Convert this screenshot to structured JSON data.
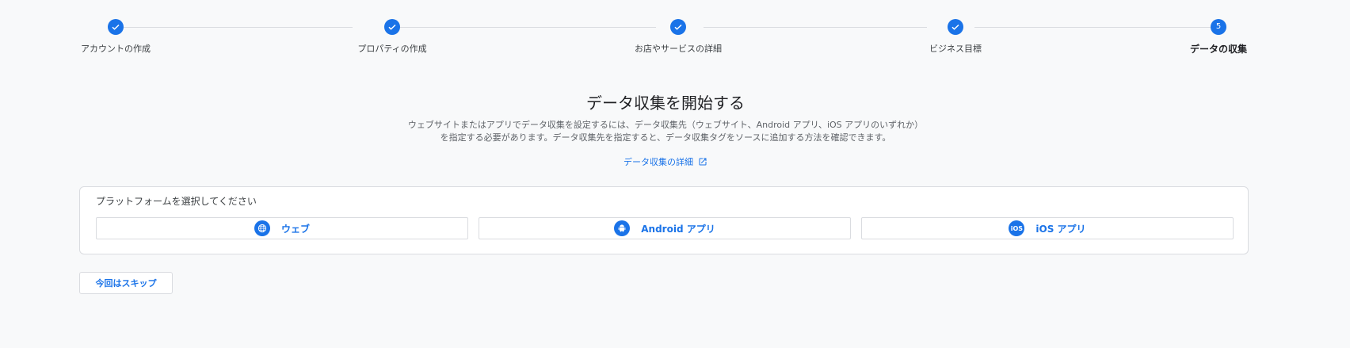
{
  "stepper": {
    "steps": [
      {
        "label": "アカウントの作成",
        "state": "done"
      },
      {
        "label": "プロパティの作成",
        "state": "done"
      },
      {
        "label": "お店やサービスの詳細",
        "state": "done"
      },
      {
        "label": "ビジネス目標",
        "state": "done"
      },
      {
        "label": "データの収集",
        "state": "active",
        "number": "5"
      }
    ]
  },
  "main": {
    "title": "データ収集を開始する",
    "description": "ウェブサイトまたはアプリでデータ収集を設定するには、データ収集先（ウェブサイト、Android アプリ、iOS アプリのいずれか）を指定する必要があります。データ収集先を指定すると、データ収集タグをソースに追加する方法を確認できます。",
    "learn_more": "データ収集の詳細"
  },
  "platform_card": {
    "title": "プラットフォームを選択してください",
    "buttons": [
      {
        "label": "ウェブ",
        "icon": "globe-icon"
      },
      {
        "label": "Android アプリ",
        "icon": "android-icon"
      },
      {
        "label": "iOS アプリ",
        "icon": "ios-icon",
        "icon_text": "iOS"
      }
    ]
  },
  "skip_button": "今回はスキップ",
  "colors": {
    "accent": "#1a73e8",
    "background": "#f8f9fa",
    "border": "#dadce0"
  }
}
